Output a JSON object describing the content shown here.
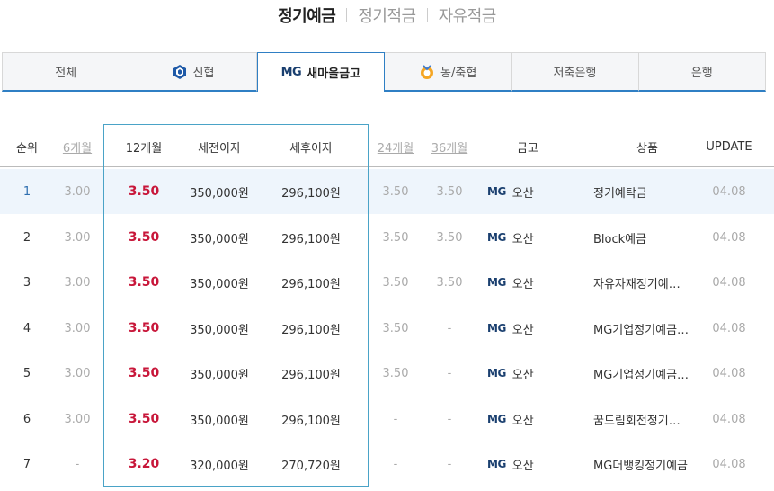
{
  "top_tabs": [
    {
      "label": "정기예금",
      "active": true
    },
    {
      "label": "정기적금",
      "active": false
    },
    {
      "label": "자유적금",
      "active": false
    }
  ],
  "institution_tabs": [
    {
      "label": "전체",
      "logo": "",
      "active": false
    },
    {
      "label": "신협",
      "logo": "shinhyup-icon",
      "active": false
    },
    {
      "label": "새마을금고",
      "logo": "MG",
      "active": true
    },
    {
      "label": "농/축협",
      "logo": "nh-icon",
      "active": false
    },
    {
      "label": "저축은행",
      "logo": "",
      "active": false
    },
    {
      "label": "은행",
      "logo": "",
      "active": false
    }
  ],
  "table": {
    "headers": {
      "rank": "순위",
      "m6": "6개월",
      "m12": "12개월",
      "pre_tax": "세전이자",
      "post_tax": "세후이자",
      "m24": "24개월",
      "m36": "36개월",
      "bank": "금고",
      "product": "상품",
      "update": "UPDATE"
    },
    "rows": [
      {
        "rank": "1",
        "m6": "3.00",
        "m12": "3.50",
        "pre_tax": "350,000원",
        "post_tax": "296,100원",
        "m24": "3.50",
        "m36": "3.50",
        "bank_logo": "MG",
        "bank": "오산",
        "product": "정기예탁금",
        "update": "04.08"
      },
      {
        "rank": "2",
        "m6": "3.00",
        "m12": "3.50",
        "pre_tax": "350,000원",
        "post_tax": "296,100원",
        "m24": "3.50",
        "m36": "3.50",
        "bank_logo": "MG",
        "bank": "오산",
        "product": "Block예금",
        "update": "04.08"
      },
      {
        "rank": "3",
        "m6": "3.00",
        "m12": "3.50",
        "pre_tax": "350,000원",
        "post_tax": "296,100원",
        "m24": "3.50",
        "m36": "3.50",
        "bank_logo": "MG",
        "bank": "오산",
        "product": "자유자재정기예…",
        "update": "04.08"
      },
      {
        "rank": "4",
        "m6": "3.00",
        "m12": "3.50",
        "pre_tax": "350,000원",
        "post_tax": "296,100원",
        "m24": "3.50",
        "m36": "-",
        "bank_logo": "MG",
        "bank": "오산",
        "product": "MG기업정기예금…",
        "update": "04.08"
      },
      {
        "rank": "5",
        "m6": "3.00",
        "m12": "3.50",
        "pre_tax": "350,000원",
        "post_tax": "296,100원",
        "m24": "3.50",
        "m36": "-",
        "bank_logo": "MG",
        "bank": "오산",
        "product": "MG기업정기예금…",
        "update": "04.08"
      },
      {
        "rank": "6",
        "m6": "3.00",
        "m12": "3.50",
        "pre_tax": "350,000원",
        "post_tax": "296,100원",
        "m24": "-",
        "m36": "-",
        "bank_logo": "MG",
        "bank": "오산",
        "product": "꿈드림회전정기…",
        "update": "04.08"
      },
      {
        "rank": "7",
        "m6": "-",
        "m12": "3.20",
        "pre_tax": "320,000원",
        "post_tax": "270,720원",
        "m24": "-",
        "m36": "-",
        "bank_logo": "MG",
        "bank": "오산",
        "product": "MG더뱅킹정기예금",
        "update": "04.08"
      }
    ]
  },
  "colors": {
    "accent": "#2f7fc4",
    "rate": "#c8173a",
    "highlight_box": "#4aa3c7",
    "first_row_bg": "#eef5fc"
  }
}
